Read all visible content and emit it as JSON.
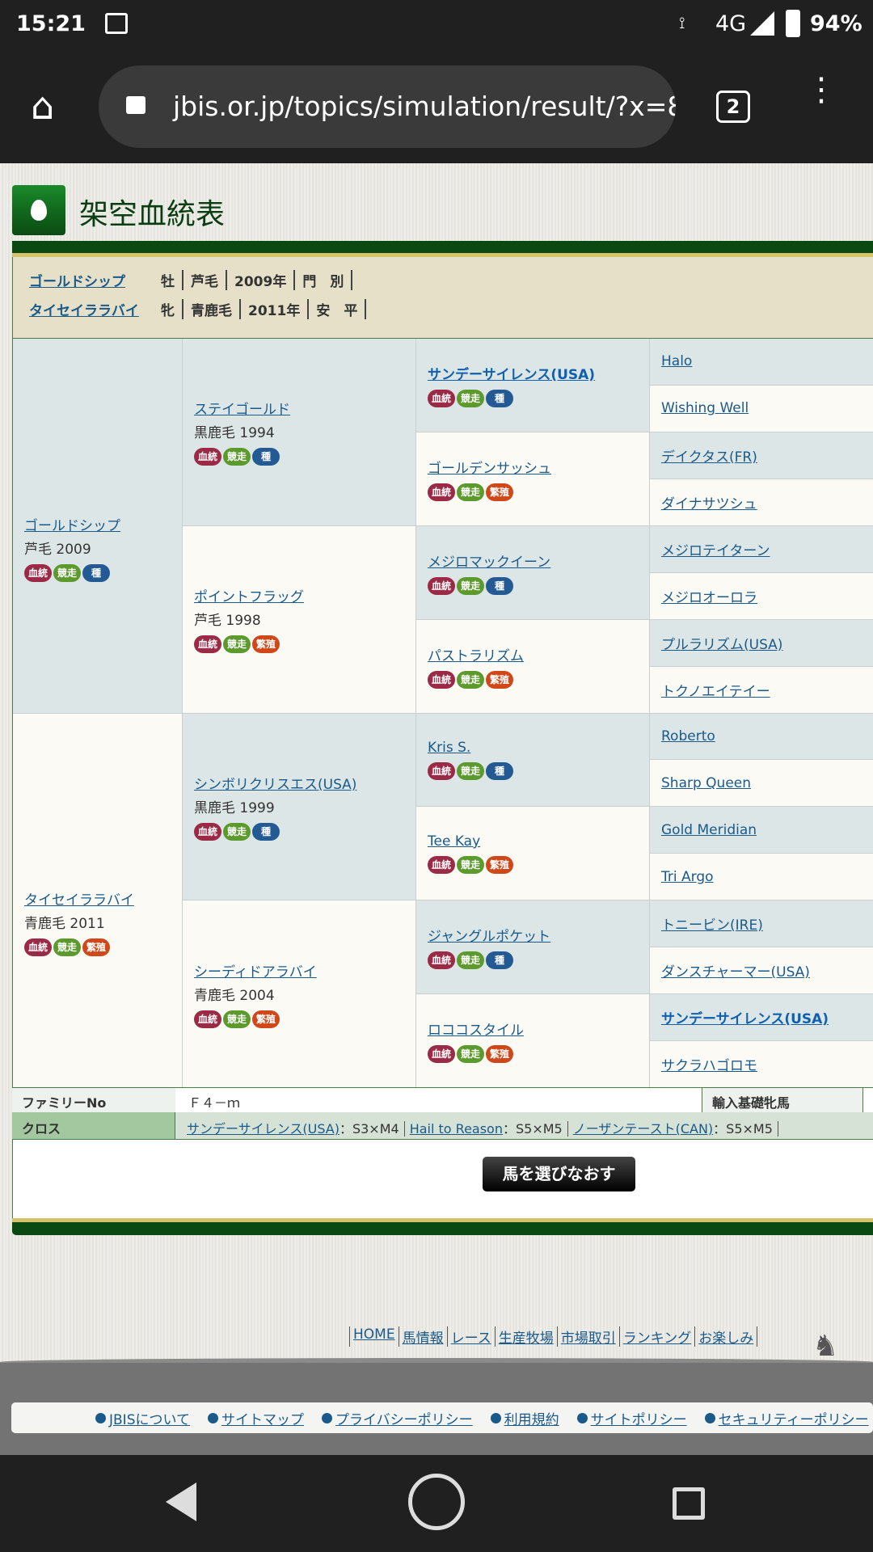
{
  "status": {
    "time": "15:21",
    "network": "4G",
    "battery": "94%"
  },
  "browser": {
    "url": "jbis.or.jp/topics/simulation/result/?x=8",
    "tab_count": "2"
  },
  "page": {
    "title": "架空血統表"
  },
  "summary": [
    {
      "name": "ゴールドシップ",
      "sex": "牡",
      "color": "芦毛",
      "year": "2009年",
      "owner": "門　別"
    },
    {
      "name": "タイセイララバイ",
      "sex": "牝",
      "color": "青鹿毛",
      "year": "2011年",
      "owner": "安　平"
    }
  ],
  "badge_labels": {
    "bl": "血統",
    "rc": "競走",
    "st": "種",
    "br": "繁殖"
  },
  "pedigree": {
    "gen1": [
      {
        "name": "ゴールドシップ",
        "info": "芦毛 2009",
        "badges": [
          "bl",
          "rc",
          "st"
        ]
      },
      {
        "name": "タイセイララバイ",
        "info": "青鹿毛 2011",
        "badges": [
          "bl",
          "rc",
          "br"
        ]
      }
    ],
    "gen2": [
      {
        "name": "ステイゴールド",
        "info": "黒鹿毛 1994",
        "badges": [
          "bl",
          "rc",
          "st"
        ]
      },
      {
        "name": "ポイントフラッグ",
        "info": "芦毛 1998",
        "badges": [
          "bl",
          "rc",
          "br"
        ]
      },
      {
        "name": "シンボリクリスエス(USA)",
        "info": "黒鹿毛 1999",
        "badges": [
          "bl",
          "rc",
          "st"
        ]
      },
      {
        "name": "シーディドアラバイ",
        "info": "青鹿毛 2004",
        "badges": [
          "bl",
          "rc",
          "br"
        ]
      }
    ],
    "gen3": [
      {
        "name": "サンデーサイレンス(USA)",
        "bold": true,
        "badges": [
          "bl",
          "rc",
          "st"
        ]
      },
      {
        "name": "ゴールデンサッシュ",
        "badges": [
          "bl",
          "rc",
          "br"
        ]
      },
      {
        "name": "メジロマックイーン",
        "badges": [
          "bl",
          "rc",
          "st"
        ]
      },
      {
        "name": "パストラリズム",
        "badges": [
          "bl",
          "rc",
          "br"
        ]
      },
      {
        "name": "Kris S.",
        "badges": [
          "bl",
          "rc",
          "st"
        ]
      },
      {
        "name": "Tee Kay",
        "badges": [
          "bl",
          "rc",
          "br"
        ]
      },
      {
        "name": "ジャングルポケット",
        "badges": [
          "bl",
          "rc",
          "st"
        ]
      },
      {
        "name": "ロココスタイル",
        "badges": [
          "bl",
          "rc",
          "br"
        ]
      }
    ],
    "gen4": [
      {
        "name": "Halo"
      },
      {
        "name": "Wishing Well"
      },
      {
        "name": "デイクタス(FR)"
      },
      {
        "name": "ダイナサツシュ"
      },
      {
        "name": "メジロテイターン"
      },
      {
        "name": "メジロオーロラ"
      },
      {
        "name": "プルラリズム(USA)"
      },
      {
        "name": "トクノエイテイー"
      },
      {
        "name": "Roberto"
      },
      {
        "name": "Sharp Queen"
      },
      {
        "name": "Gold Meridian"
      },
      {
        "name": "Tri Argo"
      },
      {
        "name": "トニービン(IRE)"
      },
      {
        "name": "ダンスチャーマー(USA)"
      },
      {
        "name": "サンデーサイレンス(USA)",
        "bold": true
      },
      {
        "name": "サクラハゴロモ"
      }
    ]
  },
  "family": {
    "label": "ファミリーNo",
    "value": "Ｆ４－ｍ",
    "import_label": "輸入基礎牝馬"
  },
  "cross": {
    "label": "クロス",
    "items": [
      {
        "name": "サンデーサイレンス(USA)",
        "value": "：S3×M4"
      },
      {
        "name": "Hail to Reason",
        "value": "：S5×M5"
      },
      {
        "name": "ノーザンテースト(CAN)",
        "value": "：S5×M5"
      }
    ]
  },
  "reselect_button": "馬を選びなおす",
  "footer_nav": [
    "HOME",
    "馬情報",
    "レース",
    "生産牧場",
    "市場取引",
    "ランキング",
    "お楽しみ"
  ],
  "footer_links": [
    "JBISについて",
    "サイトマップ",
    "プライバシーポリシー",
    "利用規約",
    "サイトポリシー",
    "セキュリティーポリシー"
  ]
}
